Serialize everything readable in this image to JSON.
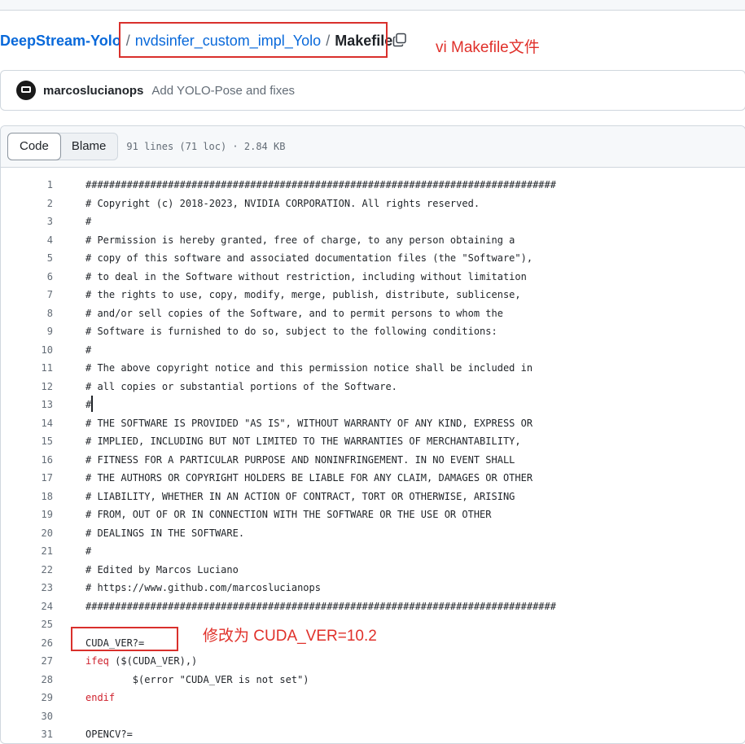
{
  "breadcrumb": {
    "repo": "DeepStream-Yolo",
    "sep1": "/",
    "dir": "nvdsinfer_custom_impl_Yolo",
    "sep2": "/",
    "file": "Makefile"
  },
  "annotations": {
    "header_note": "vi Makefile文件",
    "line_note": "修改为 CUDA_VER=10.2",
    "color": "#e0312b"
  },
  "commit": {
    "author": "marcoslucianops",
    "message": "Add YOLO-Pose and fixes"
  },
  "file_header": {
    "tabs": [
      "Code",
      "Blame"
    ],
    "active_tab": "Code",
    "info": "91 lines (71 loc) · 2.84 KB"
  },
  "icons": {
    "copy": "copy-icon",
    "avatar": "avatar"
  },
  "colors": {
    "link": "#0969da",
    "keyword": "#cf222e",
    "annotation_box": "#d9302c"
  },
  "code_lines": [
    {
      "n": "1",
      "text": "################################################################################"
    },
    {
      "n": "2",
      "text": "# Copyright (c) 2018-2023, NVIDIA CORPORATION. All rights reserved."
    },
    {
      "n": "3",
      "text": "#"
    },
    {
      "n": "4",
      "text": "# Permission is hereby granted, free of charge, to any person obtaining a"
    },
    {
      "n": "5",
      "text": "# copy of this software and associated documentation files (the \"Software\"),"
    },
    {
      "n": "6",
      "text": "# to deal in the Software without restriction, including without limitation"
    },
    {
      "n": "7",
      "text": "# the rights to use, copy, modify, merge, publish, distribute, sublicense,"
    },
    {
      "n": "8",
      "text": "# and/or sell copies of the Software, and to permit persons to whom the"
    },
    {
      "n": "9",
      "text": "# Software is furnished to do so, subject to the following conditions:"
    },
    {
      "n": "10",
      "text": "#"
    },
    {
      "n": "11",
      "text": "# The above copyright notice and this permission notice shall be included in"
    },
    {
      "n": "12",
      "text": "# all copies or substantial portions of the Software."
    },
    {
      "n": "13",
      "text": "#"
    },
    {
      "n": "14",
      "text": "# THE SOFTWARE IS PROVIDED \"AS IS\", WITHOUT WARRANTY OF ANY KIND, EXPRESS OR"
    },
    {
      "n": "15",
      "text": "# IMPLIED, INCLUDING BUT NOT LIMITED TO THE WARRANTIES OF MERCHANTABILITY,"
    },
    {
      "n": "16",
      "text": "# FITNESS FOR A PARTICULAR PURPOSE AND NONINFRINGEMENT. IN NO EVENT SHALL"
    },
    {
      "n": "17",
      "text": "# THE AUTHORS OR COPYRIGHT HOLDERS BE LIABLE FOR ANY CLAIM, DAMAGES OR OTHER"
    },
    {
      "n": "18",
      "text": "# LIABILITY, WHETHER IN AN ACTION OF CONTRACT, TORT OR OTHERWISE, ARISING"
    },
    {
      "n": "19",
      "text": "# FROM, OUT OF OR IN CONNECTION WITH THE SOFTWARE OR THE USE OR OTHER"
    },
    {
      "n": "20",
      "text": "# DEALINGS IN THE SOFTWARE."
    },
    {
      "n": "21",
      "text": "#"
    },
    {
      "n": "22",
      "text": "# Edited by Marcos Luciano"
    },
    {
      "n": "23",
      "text": "# https://www.github.com/marcoslucianops"
    },
    {
      "n": "24",
      "text": "################################################################################"
    },
    {
      "n": "25",
      "text": ""
    },
    {
      "n": "26",
      "text": "CUDA_VER?="
    },
    {
      "n": "27",
      "kw": "ifeq",
      "text": " ($(CUDA_VER),)"
    },
    {
      "n": "28",
      "text": "\t$(error \"CUDA_VER is not set\")"
    },
    {
      "n": "29",
      "kw": "endif",
      "text": ""
    },
    {
      "n": "30",
      "text": ""
    },
    {
      "n": "31",
      "text": "OPENCV?="
    }
  ]
}
